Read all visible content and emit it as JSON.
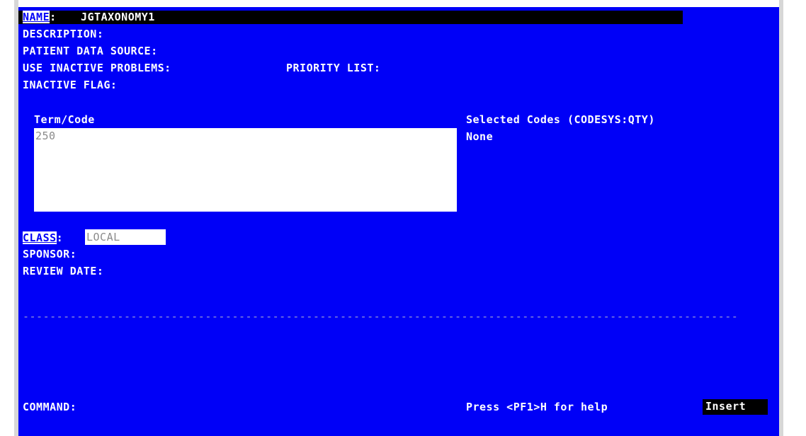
{
  "fields": {
    "name_label": "NAME",
    "name_sep": ":",
    "name_value": "JGTAXONOMY1",
    "description_label": "DESCRIPTION:",
    "patient_data_source_label": "PATIENT DATA SOURCE:",
    "use_inactive_problems_label": "USE INACTIVE PROBLEMS:",
    "priority_list_label": "PRIORITY LIST:",
    "inactive_flag_label": "INACTIVE FLAG:",
    "term_code_label": "Term/Code",
    "term_code_value": "250",
    "selected_codes_label": "Selected Codes (CODESYS:QTY)",
    "selected_codes_value": "None",
    "class_label": "CLASS",
    "class_sep": ":",
    "class_value": "LOCAL",
    "sponsor_label": "SPONSOR:",
    "review_date_label": "REVIEW DATE:"
  },
  "separator": "----------------------------------------------------------------------------------------------------------",
  "footer": {
    "command_label": "COMMAND:",
    "help_text": "Press <PF1>H for help",
    "insert_mode": "Insert"
  },
  "colors": {
    "screen_background": "#0000f7",
    "text": "#ffffff",
    "input_background": "#ffffff",
    "input_text": "#8b8b8b",
    "highlight_background": "#000000"
  }
}
